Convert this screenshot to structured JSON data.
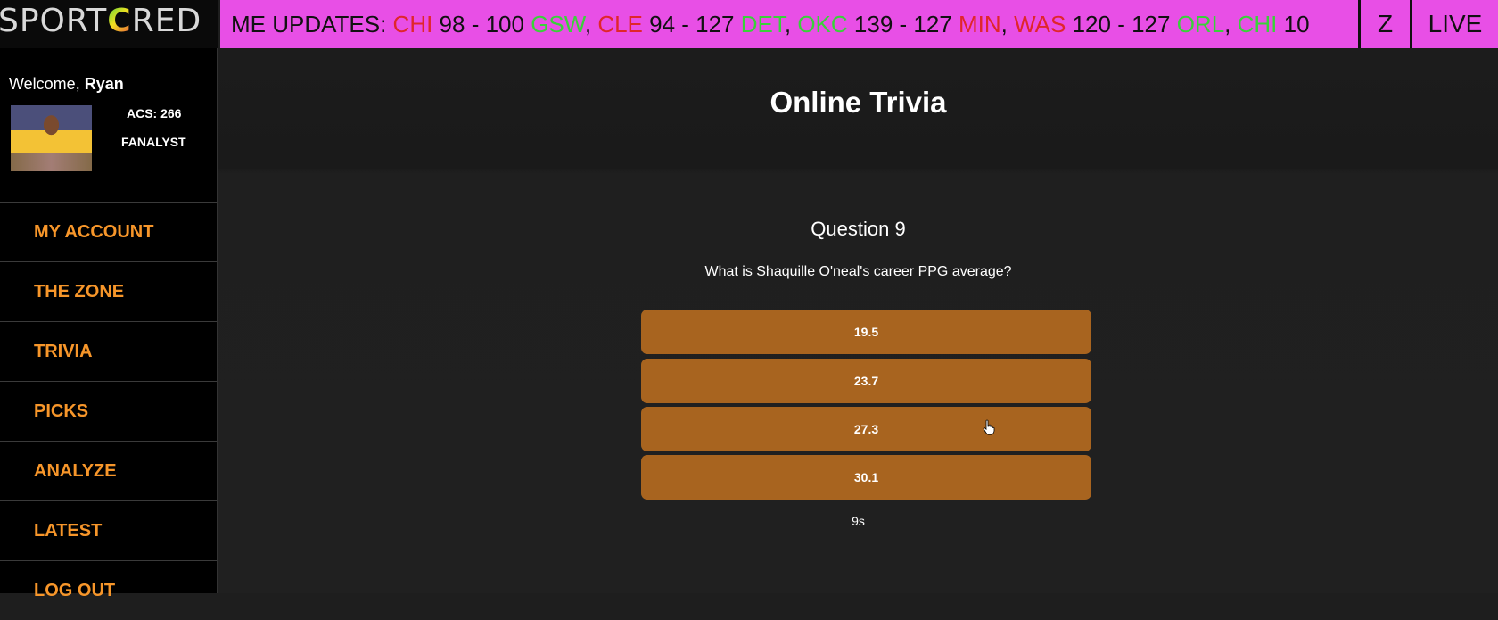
{
  "logo": {
    "wordmark_pre": "SPORT",
    "wordmark_c": "C",
    "wordmark_post": "RED"
  },
  "ticker": {
    "segments": [
      {
        "text": "ME UPDATES: ",
        "color": "#111111"
      },
      {
        "text": "CHI",
        "color": "#e0262b"
      },
      {
        "text": " 98 - 100 ",
        "color": "#111111"
      },
      {
        "text": "GSW",
        "color": "#3ad13a"
      },
      {
        "text": ", ",
        "color": "#111111"
      },
      {
        "text": "CLE",
        "color": "#e0262b"
      },
      {
        "text": " 94 - 127 ",
        "color": "#111111"
      },
      {
        "text": "DET",
        "color": "#3ad13a"
      },
      {
        "text": ", ",
        "color": "#111111"
      },
      {
        "text": "OKC",
        "color": "#3ad13a"
      },
      {
        "text": " 139 - 127 ",
        "color": "#111111"
      },
      {
        "text": "MIN",
        "color": "#e0262b"
      },
      {
        "text": ", ",
        "color": "#111111"
      },
      {
        "text": "WAS",
        "color": "#e0262b"
      },
      {
        "text": " 120 - 127 ",
        "color": "#111111"
      },
      {
        "text": "ORL",
        "color": "#3ad13a"
      },
      {
        "text": ", ",
        "color": "#111111"
      },
      {
        "text": "CHI",
        "color": "#3ad13a"
      },
      {
        "text": " 10",
        "color": "#111111"
      }
    ]
  },
  "header": {
    "zone_button": "Z",
    "live_button": "LIVE"
  },
  "user": {
    "welcome_prefix": "Welcome, ",
    "name": "Ryan",
    "acs": "ACS: 266",
    "rank": "FANALYST"
  },
  "nav": {
    "items": [
      {
        "label": "MY ACCOUNT"
      },
      {
        "label": "THE ZONE"
      },
      {
        "label": "TRIVIA"
      },
      {
        "label": "PICKS"
      },
      {
        "label": "ANALYZE"
      },
      {
        "label": "LATEST"
      },
      {
        "label": "LOG OUT"
      }
    ]
  },
  "trivia": {
    "page_title": "Online Trivia",
    "question_title": "Question 9",
    "question_text": "What is Shaquille O'neal's career PPG average?",
    "answers": [
      "19.5",
      "23.7",
      "27.3",
      "30.1"
    ],
    "timer": "9s"
  },
  "colors": {
    "accent_orange": "#f7962a",
    "answer_bg": "#a8641f",
    "ticker_bg": "#e84fe6"
  }
}
